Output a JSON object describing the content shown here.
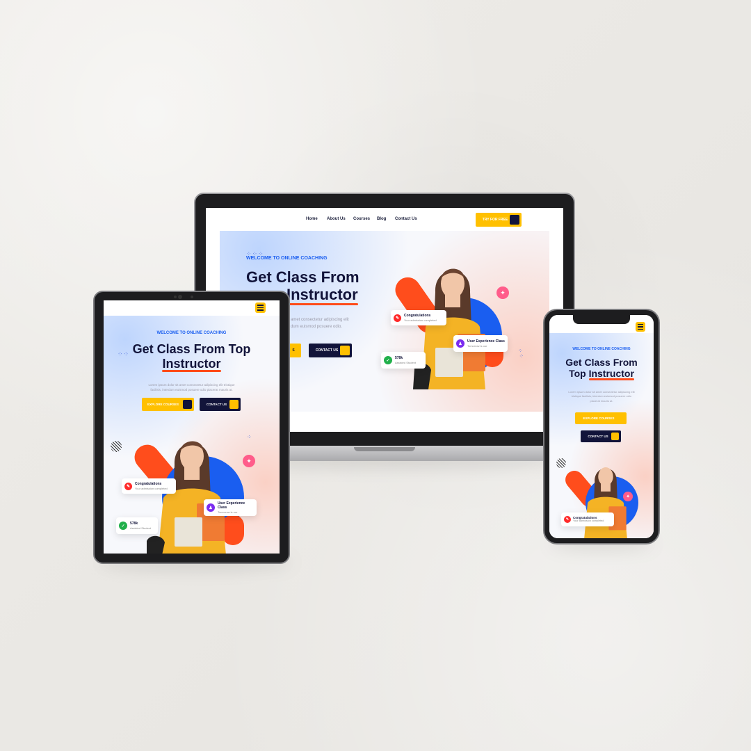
{
  "colors": {
    "accent_yellow": "#ffc000",
    "dark_navy": "#12143a",
    "brand_blue": "#1a5ef0",
    "orange": "#ff4d1c"
  },
  "laptop": {
    "nav": [
      "Home",
      "About Us",
      "Courses",
      "Blog",
      "Contact Us"
    ],
    "cta": "TRY FOR FREE",
    "eyebrow": "WELCOME TO ONLINE COACHING",
    "title_line1": "Get Class From",
    "title_hl": "Instructor",
    "para_line1": "amet consectetur adipiscing elit",
    "para_line2": "dum euismod posuere odio.",
    "contact_btn": "CONTACT US",
    "explore_btn": "S",
    "card1": {
      "title": "Congratulations",
      "sub": "Your admission completed"
    },
    "card2": {
      "title": "User Experience Class",
      "sub": "Tomorrow is our"
    },
    "card3": {
      "title": "578k",
      "sub": "Assisted Student"
    }
  },
  "tablet": {
    "eyebrow": "WELCOME TO ONLINE COACHING",
    "title_line1": "Get Class From Top",
    "title_hl": "Instructor",
    "para_line1": "Lorem ipsum dolor sit amet consectetur adipiscing elit tristique",
    "para_line2": "facilisis, interdum euismod posuere odio placerat mauris at.",
    "explore_btn": "EXPLORE COURSES",
    "contact_btn": "CONTACT US",
    "card1": {
      "title": "Congratulations",
      "sub": "Your admission completed"
    },
    "card2": {
      "title": "User Experience Class",
      "sub": "Tomorrow is our"
    },
    "card3": {
      "title": "578k",
      "sub": "Assisted Student"
    }
  },
  "phone": {
    "eyebrow": "WELCOME TO ONLINE COACHING",
    "title_line1": "Get Class From",
    "title_line2a": "Top ",
    "title_hl": "Instructor",
    "para_line1": "Lorem ipsum dolor sit amet consectetur adipiscing elit",
    "para_line2": "tristique facilisis, interdum euismod posuere odio",
    "para_line3": "placerat mauris at.",
    "explore_btn": "EXPLORE COURSES",
    "contact_btn": "CONTACT US",
    "card1": {
      "title": "Congratulations",
      "sub": "Your admission completed"
    }
  },
  "icons": {
    "menu": "hamburger-icon",
    "bulb": "lightbulb-icon",
    "cert": "certificate-icon",
    "user": "user-icon",
    "grad": "graduation-cap-icon"
  }
}
